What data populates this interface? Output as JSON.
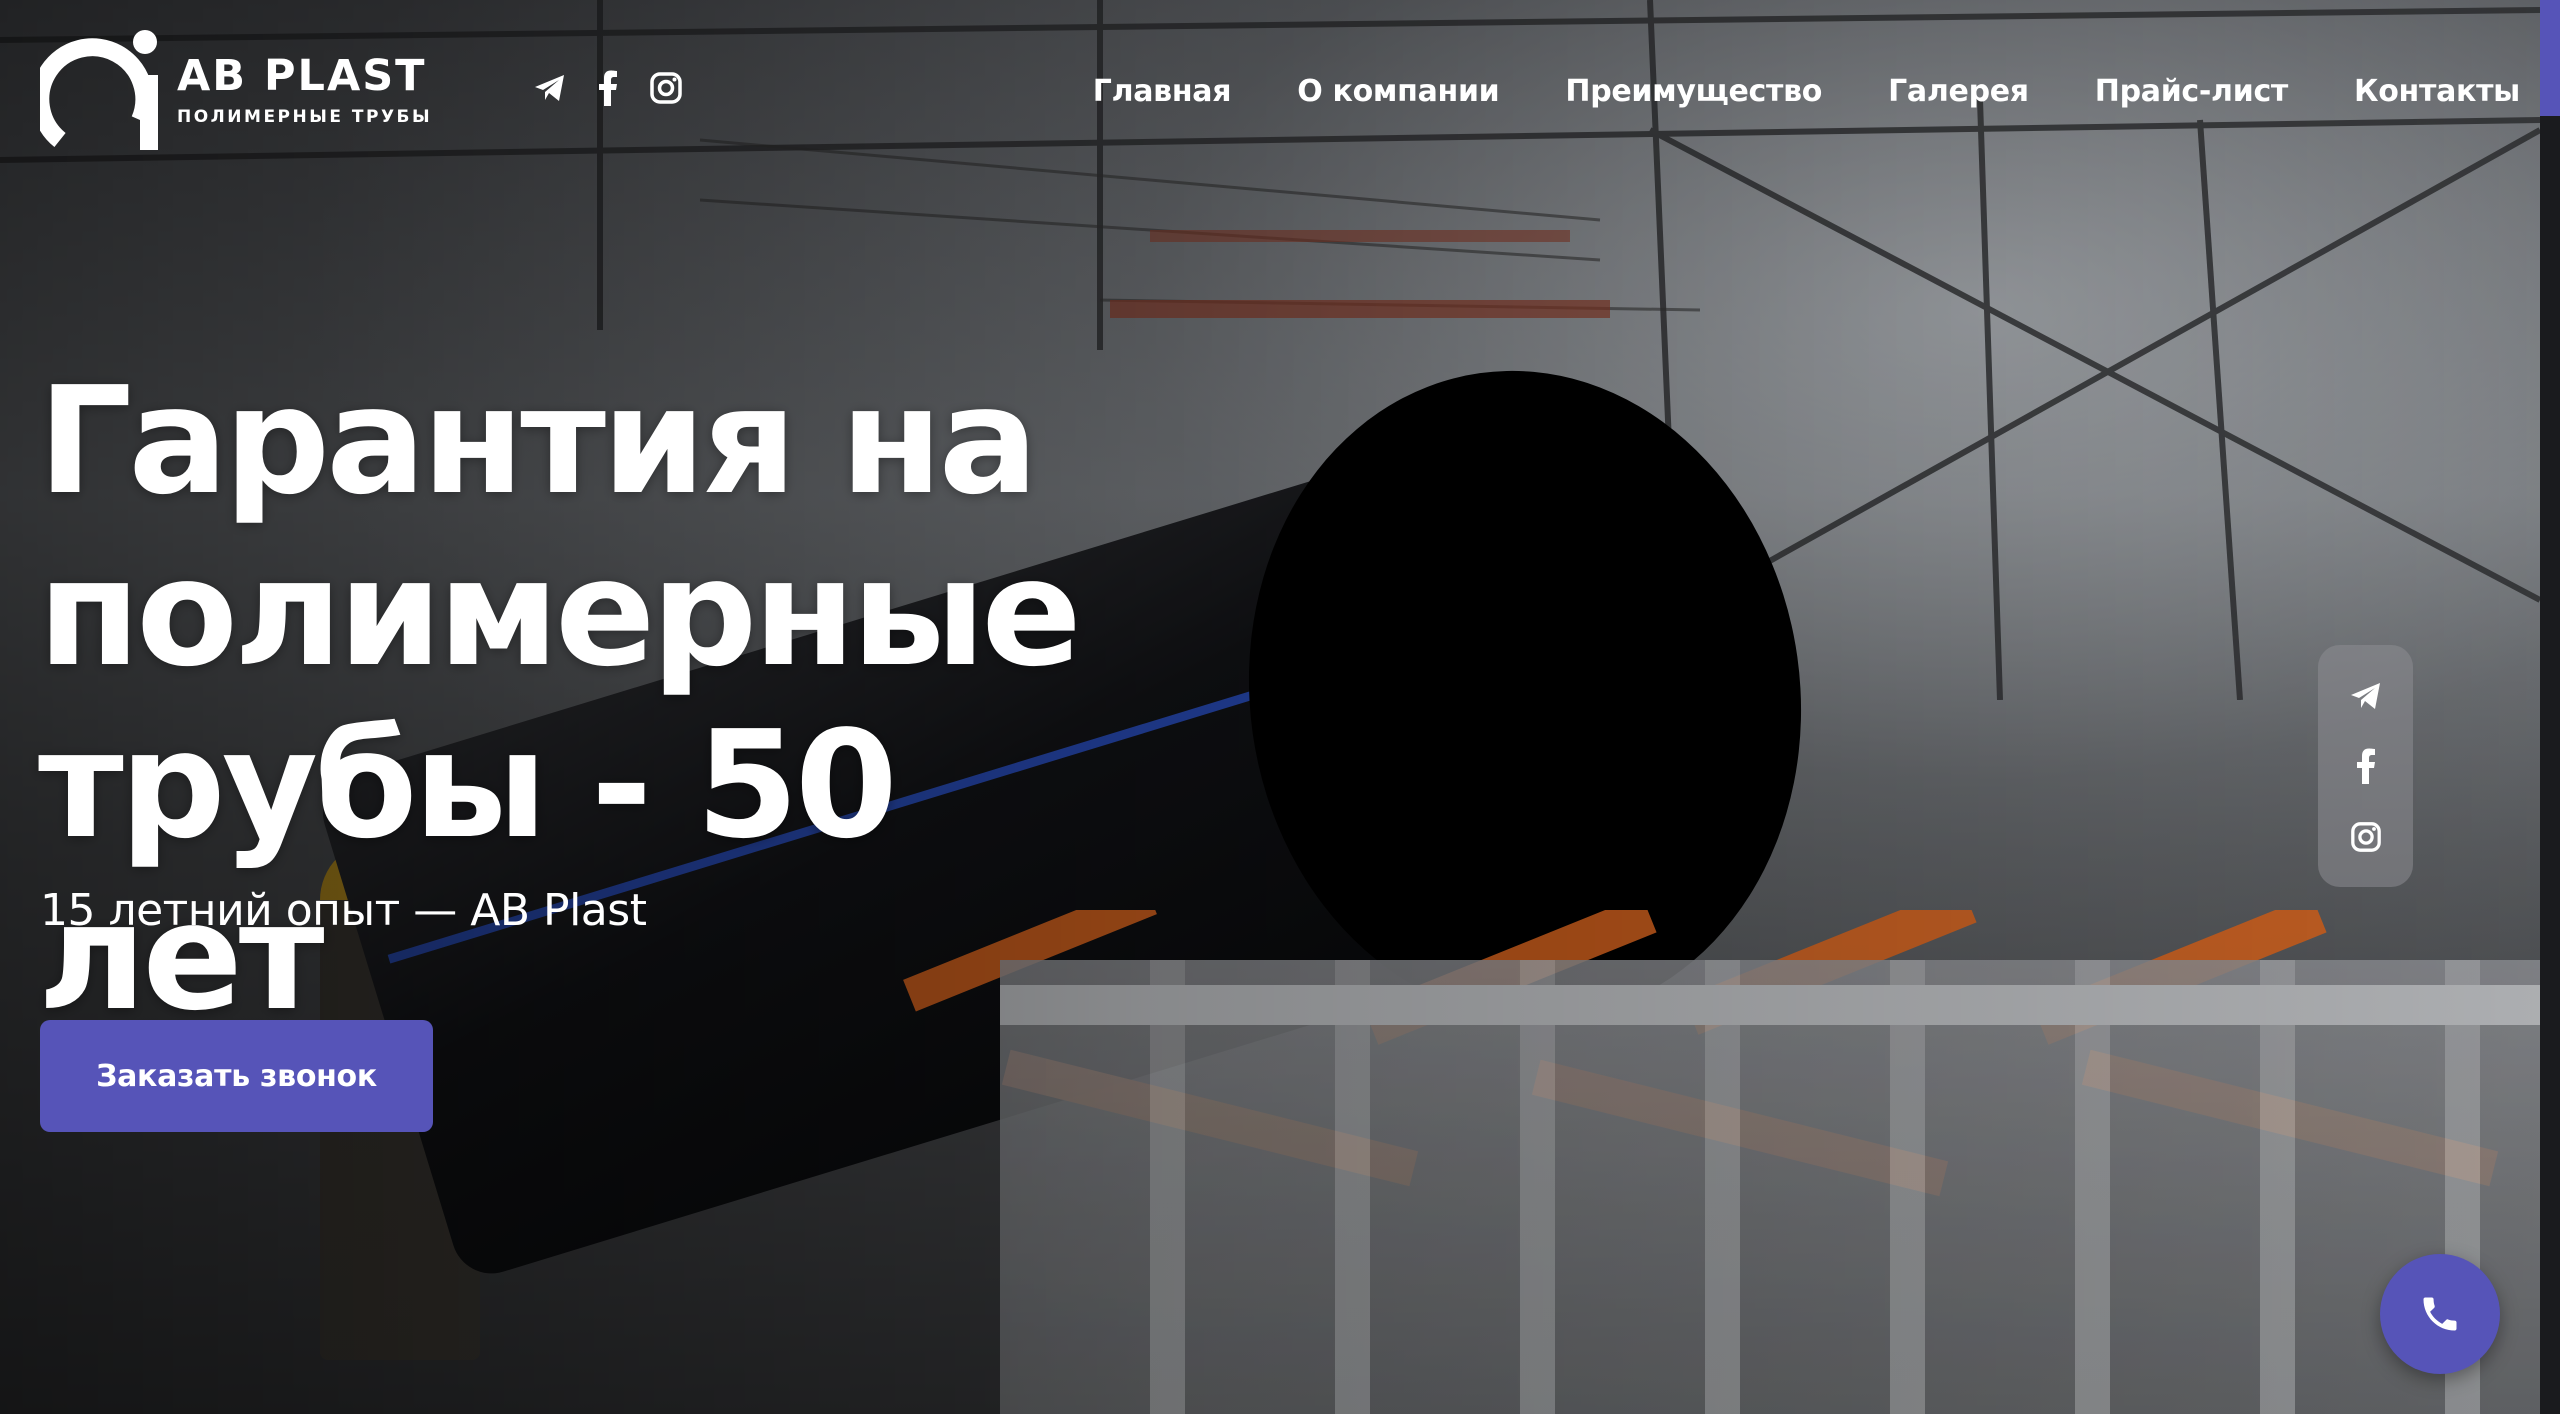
{
  "brand": {
    "name": "AB PLAST",
    "tagline": "ПОЛИМЕРНЫЕ ТРУБЫ"
  },
  "header": {
    "social_icons": [
      "telegram-icon",
      "facebook-icon",
      "instagram-icon"
    ]
  },
  "nav": {
    "items": [
      {
        "label": "Главная"
      },
      {
        "label": "О компании"
      },
      {
        "label": "Преимущество"
      },
      {
        "label": "Галерея"
      },
      {
        "label": "Прайс-лист"
      },
      {
        "label": "Контакты"
      }
    ]
  },
  "hero": {
    "headline_line1": "Гарантия на",
    "headline_line2": "полимерные",
    "headline_line3": "трубы - 50 лет",
    "subtitle": "15 летний опыт — AB Plast",
    "cta_label": "Заказать звонок"
  },
  "floating_social": {
    "icons": [
      "telegram-icon",
      "facebook-icon",
      "instagram-icon"
    ]
  },
  "call_button": {
    "icon": "phone-icon"
  },
  "colors": {
    "accent": "#5654b8",
    "text": "#ffffff"
  }
}
